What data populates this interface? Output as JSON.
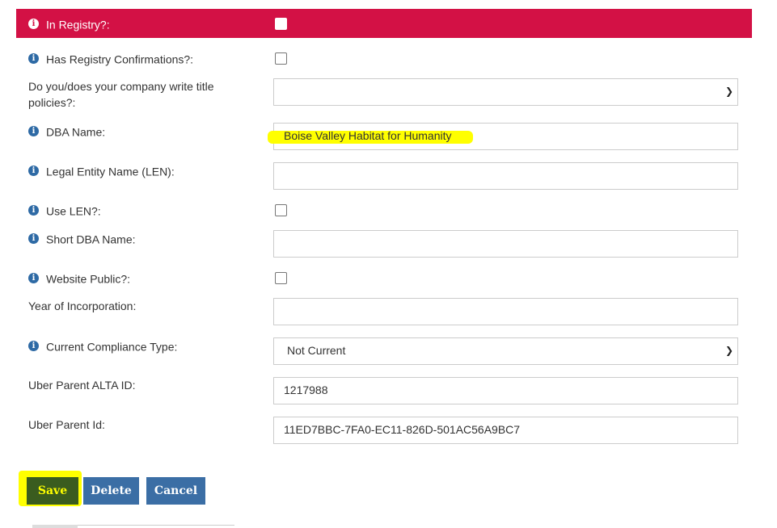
{
  "form": {
    "in_registry": {
      "label": "In Registry?:"
    },
    "has_registry_confirmations": {
      "label": "Has Registry Confirmations?:"
    },
    "title_policies": {
      "label": "Do you/does your company write title policies?:",
      "value": ""
    },
    "dba_name": {
      "label": "DBA Name:",
      "value": "Boise Valley Habitat for Humanity"
    },
    "legal_entity_name": {
      "label": "Legal Entity Name (LEN):",
      "value": ""
    },
    "use_len": {
      "label": "Use LEN?:"
    },
    "short_dba_name": {
      "label": "Short DBA Name:",
      "value": ""
    },
    "website_public": {
      "label": "Website Public?:"
    },
    "year_of_incorporation": {
      "label": "Year of Incorporation:",
      "value": ""
    },
    "current_compliance_type": {
      "label": "Current Compliance Type:",
      "value": "Not Current"
    },
    "uber_parent_alta_id": {
      "label": "Uber Parent ALTA ID:",
      "value": "1217988"
    },
    "uber_parent_id": {
      "label": "Uber Parent Id:",
      "value": "11ED7BBC-7FA0-EC11-826D-501AC56A9BC7"
    }
  },
  "buttons": {
    "save": "Save",
    "delete": "Delete",
    "cancel": "Cancel"
  },
  "colors": {
    "header_red": "#d31145",
    "button_blue": "#3b6ea5",
    "info_icon": "#2e6aa5",
    "highlight": "#ffff00"
  }
}
